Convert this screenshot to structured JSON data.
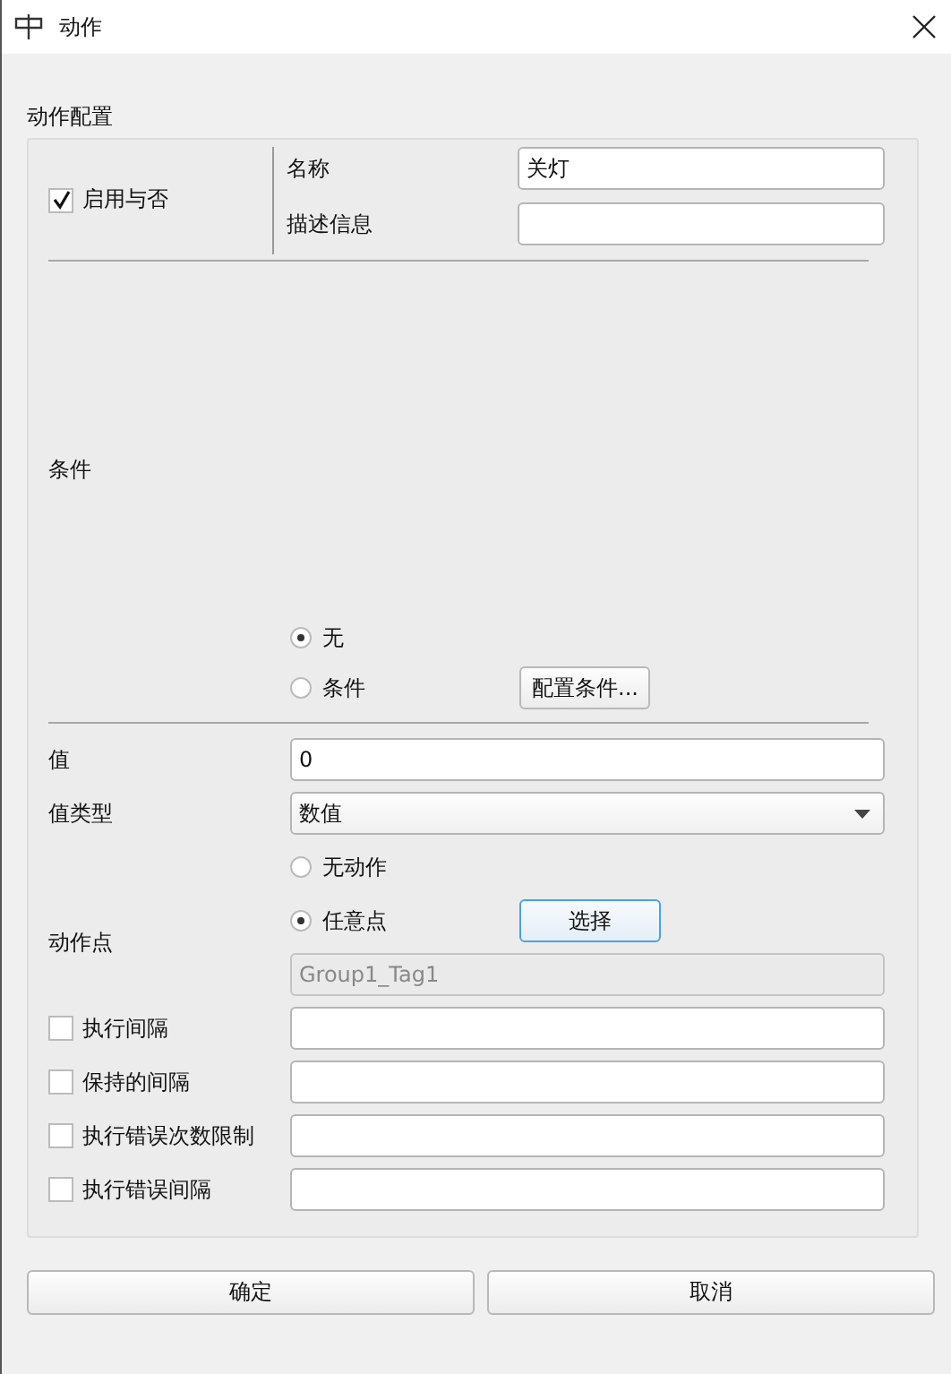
{
  "window": {
    "title": "动作"
  },
  "group": {
    "title": "动作配置"
  },
  "enable": {
    "label": "启用与否",
    "checked": true
  },
  "fields": [
    {
      "label": "名称",
      "value": "关灯"
    },
    {
      "label": "描述信息"
    }
  ],
  "condition": {
    "label": "条件",
    "options": [
      {
        "label": "无",
        "selected": true
      },
      {
        "label": "条件",
        "selected": false
      }
    ],
    "button": "配置条件..."
  },
  "value": {
    "label": "值",
    "value": "0"
  },
  "value_type": {
    "label": "值类型",
    "value": "数值"
  },
  "action_point": {
    "label": "动作点",
    "options": [
      {
        "label": "无动作",
        "selected": false
      },
      {
        "label": "任意点",
        "selected": true
      }
    ],
    "button": "选择",
    "tag_field": {
      "value": "Group1_Tag1",
      "disabled": true
    }
  },
  "options": [
    {
      "label": "执行间隔",
      "checked": false
    },
    {
      "label": "保持的间隔",
      "checked": false
    },
    {
      "label": "执行错误次数限制",
      "checked": false
    },
    {
      "label": "执行错误间隔",
      "checked": false
    }
  ],
  "buttons": [
    {
      "label": "确定"
    },
    {
      "label": "取消"
    }
  ]
}
